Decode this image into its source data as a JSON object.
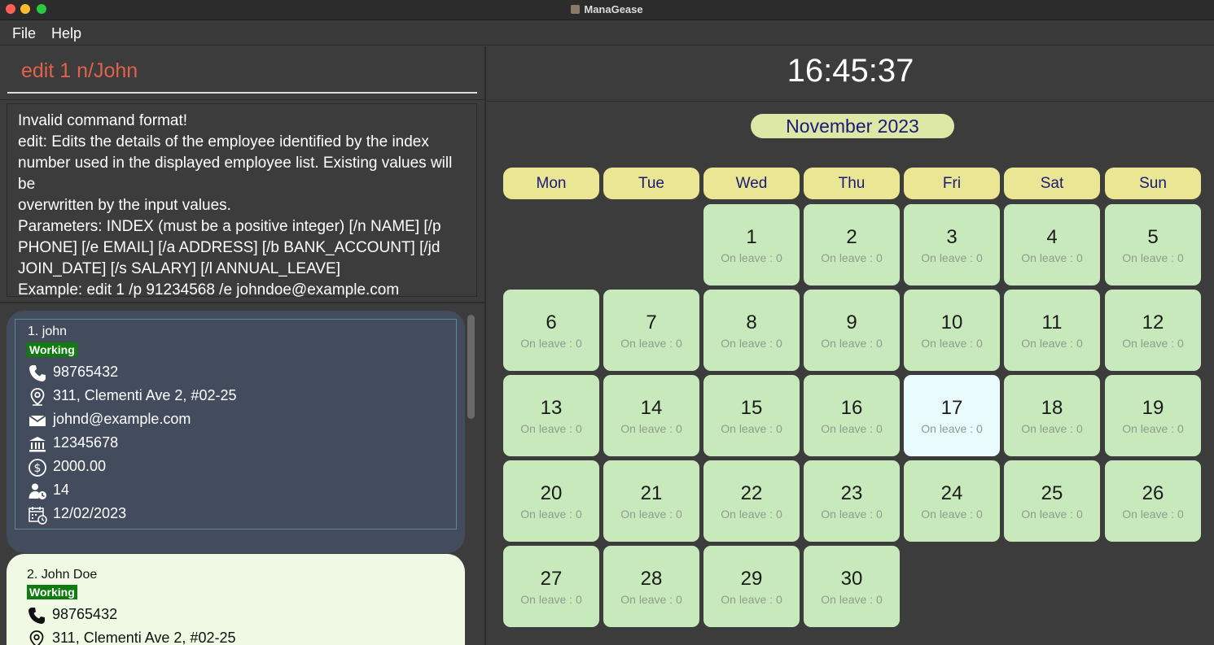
{
  "window": {
    "title": "ManaGease"
  },
  "menu": {
    "file": "File",
    "help": "Help"
  },
  "command": {
    "value": "edit 1 n/John"
  },
  "result": {
    "lines": [
      "Invalid command format!",
      "edit: Edits the details of the employee identified by the index",
      "number used in the displayed employee list. Existing values will be",
      "overwritten by the input values.",
      "Parameters: INDEX (must be a positive integer) [/n NAME] [/p",
      "PHONE] [/e EMAIL] [/a ADDRESS] [/b BANK_ACCOUNT] [/jd",
      "JOIN_DATE] [/s SALARY] [/l ANNUAL_LEAVE]",
      "Example: edit 1 /p 91234568 /e johndoe@example.com"
    ]
  },
  "employees": [
    {
      "name": "1.  john",
      "status": "Working",
      "phone": "98765432",
      "address": "311, Clementi Ave 2, #02-25",
      "email": "johnd@example.com",
      "bank": "12345678",
      "salary": "2000.00",
      "leave": "14",
      "join_date": "12/02/2023"
    },
    {
      "name": "2.  John Doe",
      "status": "Working",
      "phone": "98765432",
      "address": "311, Clementi Ave 2, #02-25"
    }
  ],
  "clock": {
    "time": "16:45:37"
  },
  "calendar": {
    "month": "November 2023",
    "weekdays": [
      "Mon",
      "Tue",
      "Wed",
      "Thu",
      "Fri",
      "Sat",
      "Sun"
    ],
    "leave_label": "On leave : 0",
    "first_weekday_index": 2,
    "days": [
      "1",
      "2",
      "3",
      "4",
      "5",
      "6",
      "7",
      "8",
      "9",
      "10",
      "11",
      "12",
      "13",
      "14",
      "15",
      "16",
      "17",
      "18",
      "19",
      "20",
      "21",
      "22",
      "23",
      "24",
      "25",
      "26",
      "27",
      "28",
      "29",
      "30"
    ],
    "today": "17",
    "colors": {
      "day": "#c8e9bb",
      "today": "#e9fbfd",
      "weekday": "#ebe693",
      "month": "#dde8a6"
    }
  },
  "icons": [
    "phone-icon",
    "location-icon",
    "email-icon",
    "bank-icon",
    "salary-icon",
    "leave-icon",
    "calendar-icon"
  ]
}
